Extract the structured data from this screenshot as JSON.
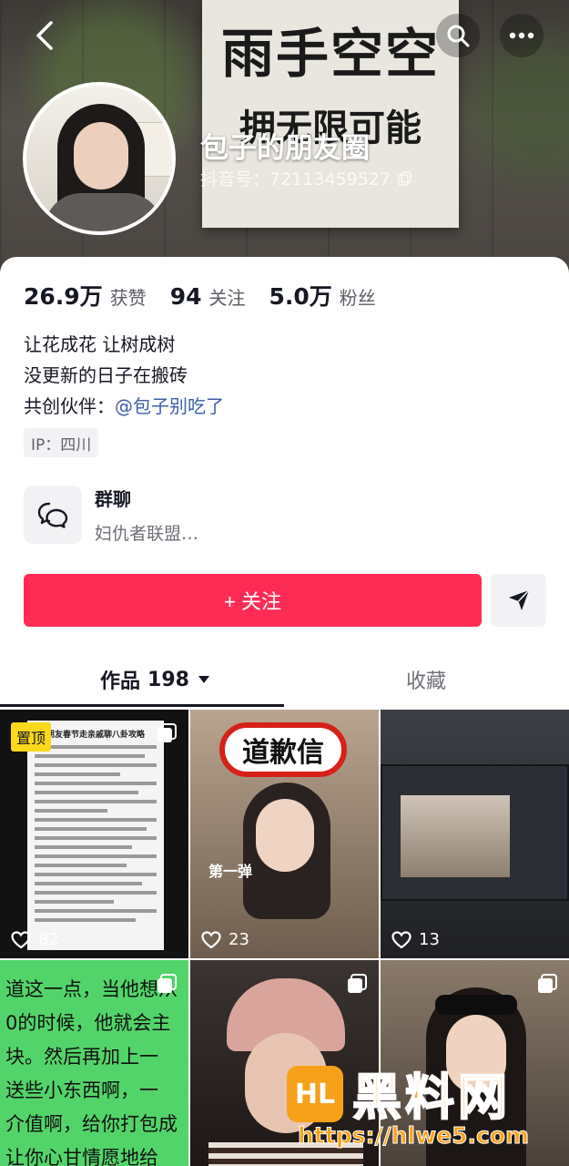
{
  "banner": {
    "poster_line1": "雨手空空",
    "poster_line2": "拥无限可能"
  },
  "profile": {
    "nickname": "包子的朋友圈",
    "douyin_id": "抖音号：72113459527"
  },
  "stats": [
    {
      "value": "26.9万",
      "label": "获赞"
    },
    {
      "value": "94",
      "label": "关注"
    },
    {
      "value": "5.0万",
      "label": "粉丝"
    }
  ],
  "bio": {
    "line1": "让花成花 让树成树",
    "line2": "没更新的日子在搬砖",
    "partner_prefix": "共创伙伴：",
    "partner_mention": "@包子别吃了"
  },
  "ip": "IP：四川",
  "group": {
    "title": "群聊",
    "subtitle": "妇仇者联盟…"
  },
  "actions": {
    "follow_label": "+ 关注"
  },
  "tabs": {
    "works_label": "作品",
    "works_count": "198",
    "favorites_label": "收藏"
  },
  "posts": [
    {
      "likes": "82",
      "pinned_label": "置顶",
      "doc_title": "朋友春节走亲戚聊八卦攻略"
    },
    {
      "likes": "23",
      "title": "道歉信",
      "caption": "第一弹"
    },
    {
      "likes": "13"
    },
    {
      "text_lines": [
        "道这一点，当他想从",
        "0的时候，他就会主",
        "块。然后再加上一",
        "送些小东西啊，一",
        "介值啊，给你打包成",
        "让你心甘情愿地给"
      ]
    },
    {},
    {}
  ],
  "watermark": {
    "logo_text": "HL",
    "title": "黑料网",
    "url": "https://hlwe5.com"
  },
  "colors": {
    "accent": "#fe2c55",
    "mention": "#3c5fa8",
    "pinned": "#fad81c"
  }
}
